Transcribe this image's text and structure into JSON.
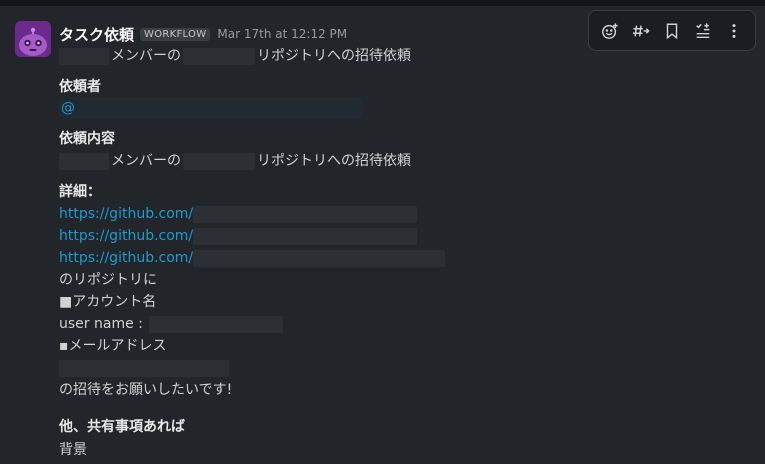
{
  "message": {
    "sender": "タスク依頼",
    "badge": "WORKFLOW",
    "timestamp": "Mar 17th at 12:12 PM",
    "title_suffix": "メンバーの",
    "title_tail": "リポジトリへの招待依頼",
    "requester_heading": "依頼者",
    "mention_prefix": "@",
    "content_heading": "依頼内容",
    "content_suffix": "メンバーの",
    "content_tail": "リポジトリへの招待依頼",
    "details_heading": "詳細：",
    "links": [
      "https://github.com/",
      "https://github.com/",
      "https://github.com/"
    ],
    "repo_line": "のリポジトリに",
    "account_heading": "■アカウント名",
    "username_label": "user name :",
    "email_heading": "▪メールアドレス",
    "closing": "の招待をお願いしたいです!",
    "other_heading": "他、共有事項あれば",
    "background_label": "背景"
  },
  "toolbar": {
    "icons": [
      "add-reaction-icon",
      "channel-share-icon",
      "bookmark-icon",
      "task-list-icon",
      "more-icon"
    ]
  }
}
